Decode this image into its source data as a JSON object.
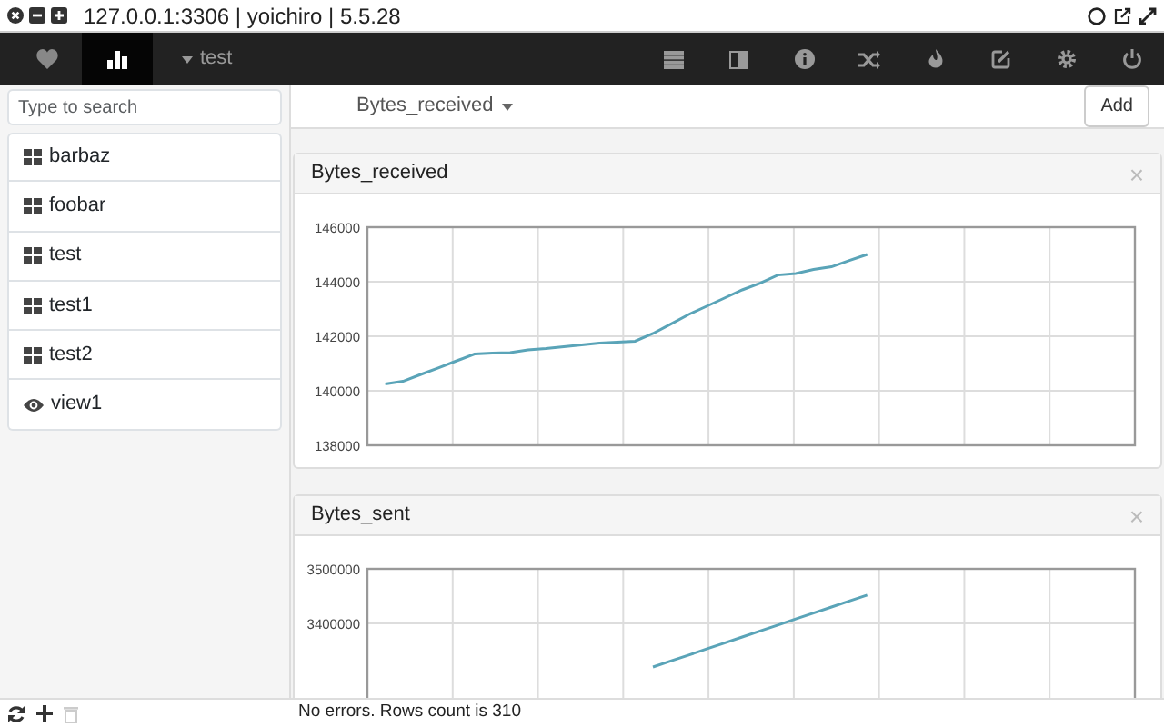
{
  "window": {
    "title": "127.0.0.1:3306 | yoichiro | 5.5.28"
  },
  "nav_tabs": [
    {
      "kind": "favorites",
      "selected": false
    },
    {
      "kind": "charts",
      "selected": true
    }
  ],
  "database_menu": {
    "label": "test"
  },
  "toolbar_icons": [
    {
      "kind": "list"
    },
    {
      "kind": "columns"
    },
    {
      "kind": "info"
    },
    {
      "kind": "shuffle"
    },
    {
      "kind": "fire"
    },
    {
      "kind": "edit"
    },
    {
      "kind": "gear"
    },
    {
      "kind": "power"
    }
  ],
  "sidebar": {
    "search": {
      "placeholder": "Type to search"
    },
    "items": [
      {
        "label": "barbaz",
        "kind": "table"
      },
      {
        "label": "foobar",
        "kind": "table"
      },
      {
        "label": "test",
        "kind": "table"
      },
      {
        "label": "test1",
        "kind": "table"
      },
      {
        "label": "test2",
        "kind": "table"
      },
      {
        "label": "view1",
        "kind": "view"
      }
    ]
  },
  "variable_select": {
    "label": "Bytes_received"
  },
  "add_button": "Add",
  "panels": [
    {
      "close": "×",
      "chart_data": {
        "type": "line",
        "title": "Bytes_received",
        "grid": true,
        "categories": [
          null,
          null,
          null,
          null,
          null,
          null,
          null,
          null,
          null,
          null,
          null,
          null,
          null,
          null,
          null,
          null,
          null,
          null,
          null,
          null,
          null,
          null,
          null,
          null,
          null,
          null,
          null,
          null,
          null,
          null,
          null,
          null,
          null,
          null,
          null,
          null,
          null,
          null,
          null,
          null,
          null,
          null,
          null,
          null
        ],
        "ylim": [
          138000,
          146000
        ],
        "yticks": [
          138000,
          140000,
          142000,
          144000,
          146000
        ],
        "series": [
          {
            "color": "#5aa4b8",
            "values": [
              null,
              140250,
              140350,
              140600,
              140850,
              141100,
              141350,
              141380,
              141400,
              141500,
              141550,
              141620,
              141680,
              141750,
              141780,
              141820,
              142100,
              142450,
              142800,
              143100,
              143400,
              143700,
              143950,
              144250,
              144300,
              144450,
              144550,
              144780,
              145000,
              null,
              null,
              null,
              null,
              null,
              null,
              null,
              null,
              null,
              null,
              null,
              null,
              null,
              null,
              null
            ]
          }
        ]
      }
    },
    {
      "close": "×",
      "chart_data": {
        "type": "line",
        "title": "Bytes_sent",
        "grid": true,
        "categories": [
          null,
          null,
          null,
          null,
          null,
          null,
          null,
          null,
          null,
          null,
          null,
          null,
          null,
          null,
          null,
          null,
          null,
          null,
          null,
          null,
          null,
          null,
          null,
          null,
          null,
          null,
          null,
          null,
          null,
          null,
          null,
          null,
          null,
          null,
          null,
          null,
          null,
          null,
          null,
          null,
          null,
          null,
          null,
          null
        ],
        "ylim": [
          3100000,
          3500000
        ],
        "yticks": [
          3400000,
          3500000
        ],
        "series": [
          {
            "color": "#5aa4b8",
            "values": [
              null,
              null,
              null,
              null,
              null,
              null,
              null,
              null,
              null,
              null,
              null,
              null,
              null,
              null,
              null,
              null,
              3320000,
              3331000,
              3342000,
              3353000,
              3364000,
              3375000,
              3386000,
              3397000,
              3408000,
              3419000,
              3430000,
              3441000,
              3452000,
              null,
              null,
              null,
              null,
              null,
              null,
              null,
              null,
              null,
              null,
              null,
              null,
              null,
              null,
              null
            ]
          }
        ]
      }
    }
  ],
  "status_bar": {
    "text": "No errors. Rows count is 310",
    "buttons": [
      {
        "kind": "refresh",
        "disabled": false
      },
      {
        "kind": "add",
        "disabled": false
      },
      {
        "kind": "delete",
        "disabled": true
      }
    ]
  }
}
